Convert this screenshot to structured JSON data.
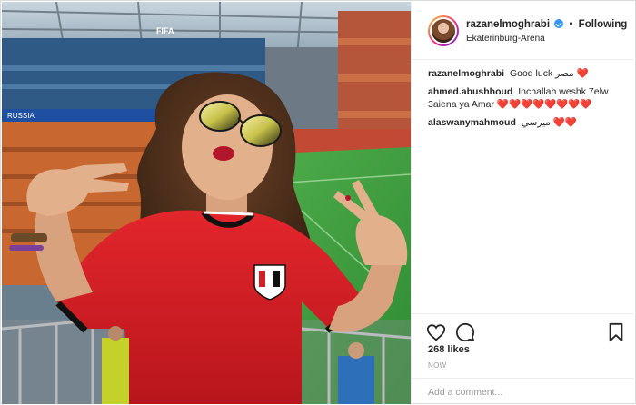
{
  "post": {
    "username": "razanelmoghrabi",
    "follow_label": "Following",
    "separator": "•",
    "location": "Ekaterinburg-Arena",
    "image_alt": "Photo of woman in red Egypt football shirt wearing mirrored sunglasses posing with peace signs at a stadium",
    "stadium_banner": "FIFA",
    "board_text": "RUSSIA",
    "comments": [
      {
        "user": "razanelmoghrabi",
        "text": "Good luck مصر ❤️"
      },
      {
        "user": "ahmed.abushhoud",
        "text": "Inchallah weshk 7elw 3aiena ya Amar ❤️❤️❤️❤️❤️❤️❤️❤️"
      },
      {
        "user": "alaswanymahmoud",
        "text": "ميرسي ❤️❤️"
      }
    ],
    "likes": "268 likes",
    "time": "NOW",
    "add_comment_placeholder": "Add a comment..."
  },
  "icons": {
    "heart": "heart-icon",
    "comment": "comment-icon",
    "bookmark": "bookmark-icon",
    "verified": "verified-badge-icon"
  },
  "colors": {
    "shirt_red": "#d41f26",
    "pitch_green": "#3f9b3d",
    "verified_blue": "#3897f0",
    "muted_text": "#999999"
  }
}
